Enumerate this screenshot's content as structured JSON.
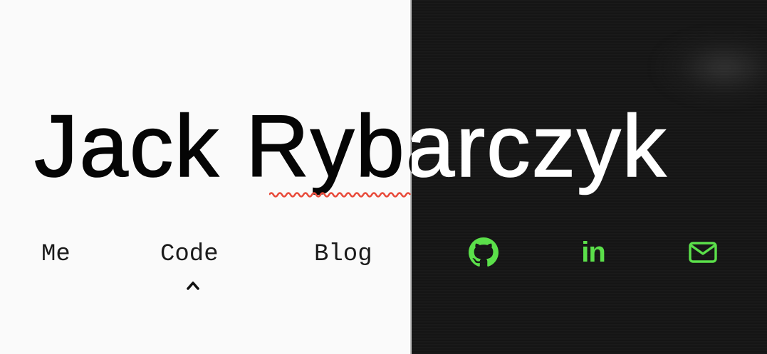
{
  "header": {
    "name": "Jack Rybarczyk"
  },
  "nav": {
    "items": [
      {
        "label": "Me"
      },
      {
        "label": "Code"
      },
      {
        "label": "Blog"
      }
    ],
    "active": "Code"
  },
  "social": {
    "links": [
      {
        "icon": "github-icon"
      },
      {
        "icon": "linkedin-icon",
        "text": "in"
      },
      {
        "icon": "mail-icon"
      }
    ],
    "color": "#5be04a"
  },
  "theme": {
    "light_bg": "#fafafa",
    "dark_bg": "#151515",
    "spellcheck_color": "#e84a3a"
  }
}
